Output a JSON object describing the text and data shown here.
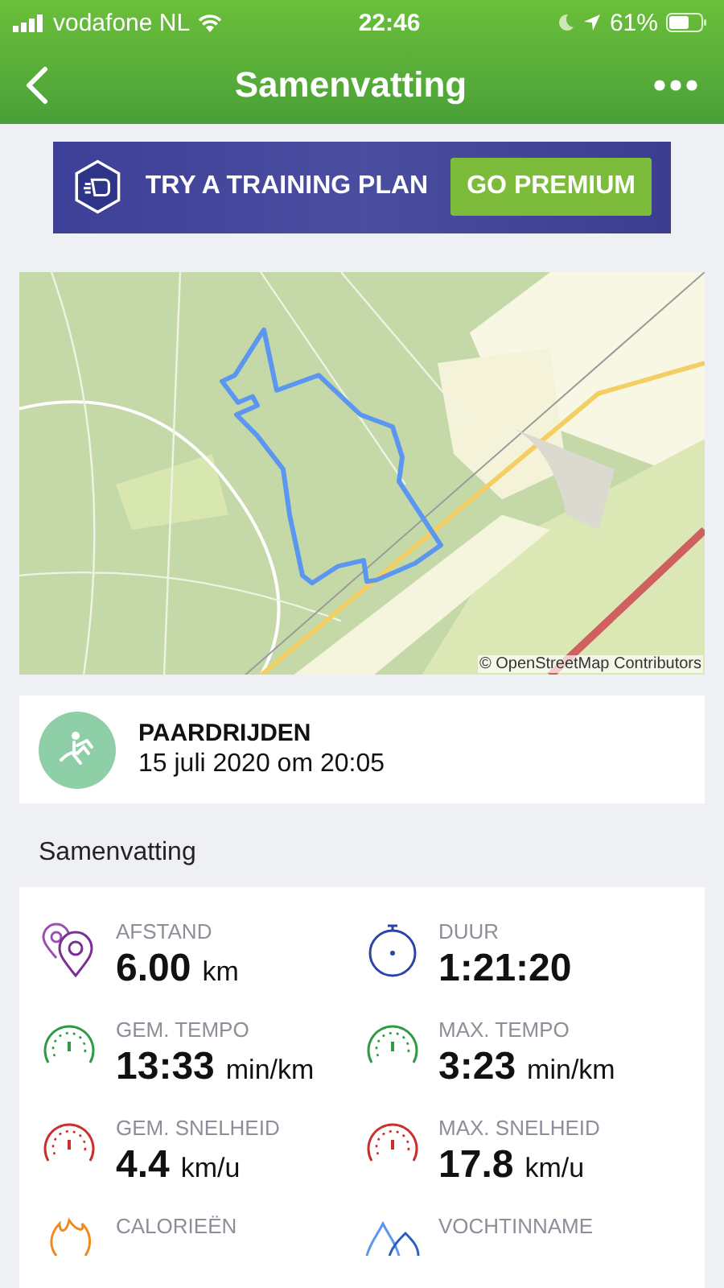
{
  "status_bar": {
    "carrier": "vodafone NL",
    "time": "22:46",
    "battery": "61%"
  },
  "nav": {
    "title": "Samenvatting"
  },
  "banner": {
    "text": "TRY A TRAINING PLAN",
    "button": "GO PREMIUM"
  },
  "map": {
    "attribution": "© OpenStreetMap Contributors"
  },
  "activity": {
    "type": "PAARDRIJDEN",
    "date": "15 juli 2020 om 20:05"
  },
  "section_title": "Samenvatting",
  "stats": [
    {
      "kind": "distance",
      "label": "AFSTAND",
      "value": "6.00",
      "unit": "km"
    },
    {
      "kind": "duration",
      "label": "DUUR",
      "value": "1:21:20"
    },
    {
      "kind": "pace",
      "label": "GEM. TEMPO",
      "value": "13:33",
      "unit": "min/km"
    },
    {
      "kind": "pace",
      "label": "MAX. TEMPO",
      "value": "3:23",
      "unit": "min/km"
    },
    {
      "kind": "speed",
      "label": "GEM. SNELHEID",
      "value": "4.4",
      "unit": "km/u"
    },
    {
      "kind": "speed",
      "label": "MAX. SNELHEID",
      "value": "17.8",
      "unit": "km/u"
    },
    {
      "kind": "calories",
      "label": "CALORIEËN"
    },
    {
      "kind": "water",
      "label": "VOCHTINNAME"
    }
  ]
}
